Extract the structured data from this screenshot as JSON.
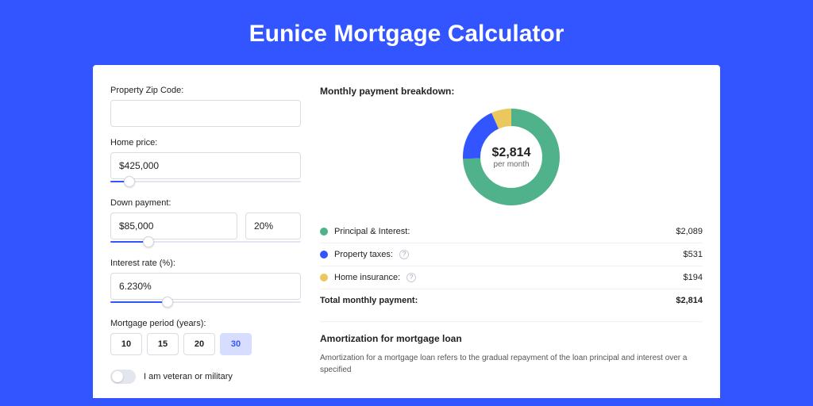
{
  "title": "Eunice Mortgage Calculator",
  "form": {
    "zip": {
      "label": "Property Zip Code:",
      "value": ""
    },
    "home_price": {
      "label": "Home price:",
      "value": "$425,000",
      "slider_pct": 10
    },
    "down_payment": {
      "label": "Down payment:",
      "amount": "$85,000",
      "pct": "20%",
      "slider_pct": 20
    },
    "interest": {
      "label": "Interest rate (%):",
      "value": "6.230%",
      "slider_pct": 30
    },
    "period": {
      "label": "Mortgage period (years):",
      "options": [
        "10",
        "15",
        "20",
        "30"
      ],
      "selected": "30"
    },
    "veteran": {
      "label": "I am veteran or military",
      "on": false
    }
  },
  "breakdown": {
    "title": "Monthly payment breakdown:",
    "center_value": "$2,814",
    "center_sub": "per month",
    "items": [
      {
        "label": "Principal & Interest:",
        "value": "$2,089",
        "color": "#4fb28b",
        "info": false
      },
      {
        "label": "Property taxes:",
        "value": "$531",
        "color": "#3355ff",
        "info": true
      },
      {
        "label": "Home insurance:",
        "value": "$194",
        "color": "#eac85d",
        "info": true
      }
    ],
    "total_label": "Total monthly payment:",
    "total_value": "$2,814"
  },
  "amort": {
    "title": "Amortization for mortgage loan",
    "text": "Amortization for a mortgage loan refers to the gradual repayment of the loan principal and interest over a specified"
  },
  "chart_data": {
    "type": "pie",
    "title": "Monthly payment breakdown",
    "series": [
      {
        "name": "Principal & Interest",
        "value": 2089,
        "color": "#4fb28b"
      },
      {
        "name": "Property taxes",
        "value": 531,
        "color": "#3355ff"
      },
      {
        "name": "Home insurance",
        "value": 194,
        "color": "#eac85d"
      }
    ],
    "total": 2814,
    "center_label": "$2,814 per month"
  }
}
